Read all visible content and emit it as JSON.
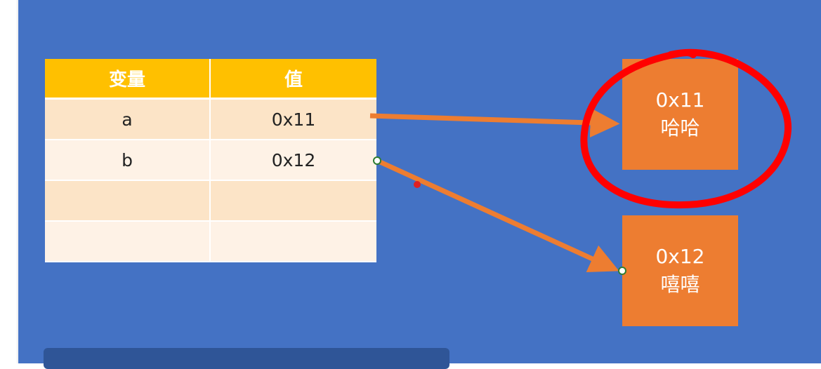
{
  "table": {
    "headers": [
      "变量",
      "值"
    ],
    "rows": [
      [
        "a",
        "0x11"
      ],
      [
        "b",
        "0x12"
      ],
      [
        "",
        ""
      ],
      [
        "",
        ""
      ]
    ]
  },
  "memory": [
    {
      "address": "0x11",
      "value": "哈哈"
    },
    {
      "address": "0x12",
      "value": "嘻嘻"
    }
  ],
  "colors": {
    "slide_bg": "#4472c4",
    "header": "#ffc000",
    "row_odd": "#fce4c7",
    "row_even": "#fef2e6",
    "box": "#ed7d31",
    "arrow": "#ed7d31",
    "annotation": "#ff0000"
  }
}
